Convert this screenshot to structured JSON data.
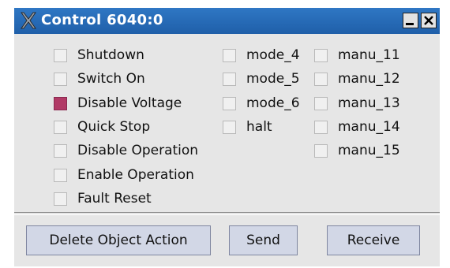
{
  "window": {
    "title": "Control 6040:0",
    "icons": {
      "app": "x-app-icon",
      "minimize": "minimize-icon",
      "close": "close-icon"
    }
  },
  "checkboxes": {
    "col1": [
      {
        "label": "Shutdown",
        "checked": false
      },
      {
        "label": "Switch On",
        "checked": false
      },
      {
        "label": "Disable Voltage",
        "checked": true
      },
      {
        "label": "Quick Stop",
        "checked": false
      },
      {
        "label": "Disable Operation",
        "checked": false
      },
      {
        "label": "Enable Operation",
        "checked": false
      },
      {
        "label": "Fault Reset",
        "checked": false
      }
    ],
    "col2": [
      {
        "label": "mode_4",
        "checked": false
      },
      {
        "label": "mode_5",
        "checked": false
      },
      {
        "label": "mode_6",
        "checked": false
      },
      {
        "label": "halt",
        "checked": false
      }
    ],
    "col3": [
      {
        "label": "manu_11",
        "checked": false
      },
      {
        "label": "manu_12",
        "checked": false
      },
      {
        "label": "manu_13",
        "checked": false
      },
      {
        "label": "manu_14",
        "checked": false
      },
      {
        "label": "manu_15",
        "checked": false
      }
    ]
  },
  "buttons": {
    "delete": "Delete Object Action",
    "send": "Send",
    "receive": "Receive"
  },
  "colors": {
    "titlebar": "#2468b6",
    "checked": "#b13a66",
    "button": "#d2d7e6"
  }
}
